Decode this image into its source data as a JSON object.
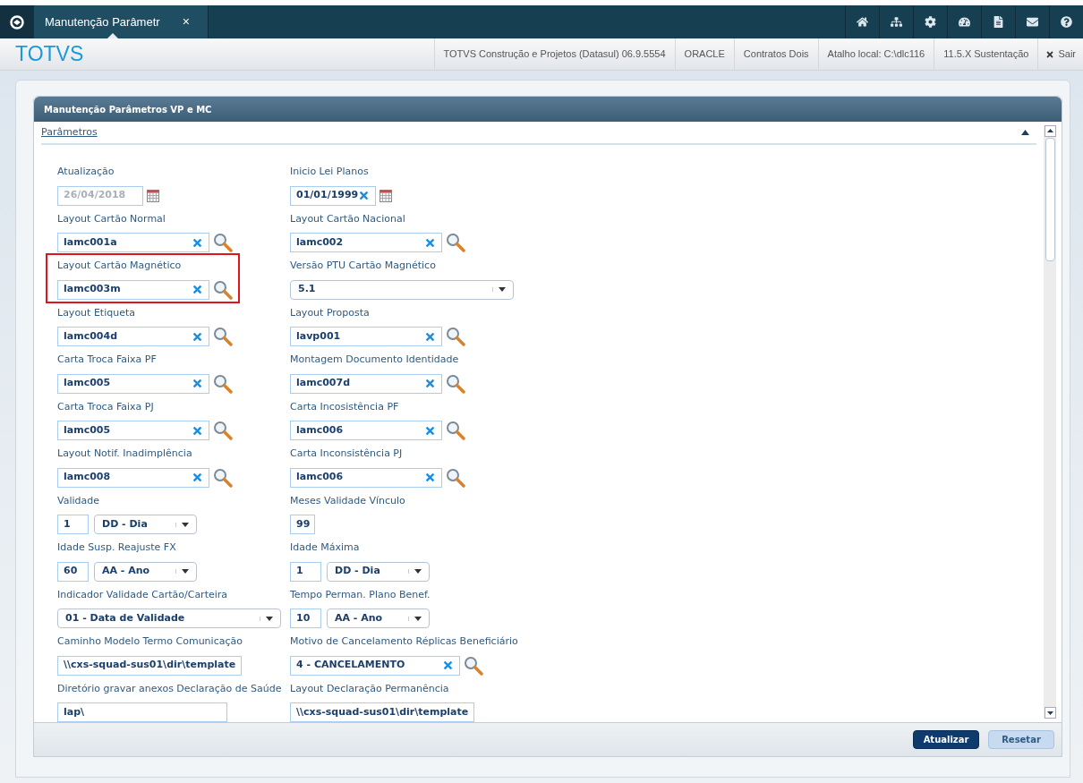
{
  "tab": {
    "title": "Manutenção Parâmetr",
    "close": "×",
    "selected": true
  },
  "brand": "TOTVS",
  "header_items": [
    "TOTVS Construção e Projetos (Datasul) 06.9.5554",
    "ORACLE",
    "Contratos Dois",
    "Atalho local: C:\\dlc116",
    "11.5.X Sustentação"
  ],
  "logout": "Sair",
  "panel": {
    "title": "Manutenção Parâmetros VP e MC",
    "section": "Parâmetros",
    "expanded": true,
    "rows": [
      [
        {
          "kind": "date",
          "label": "Atualização",
          "value": "26/04/2018",
          "disabled": true,
          "highlighted": false
        },
        {
          "kind": "date",
          "label": "Inicio Lei Planos",
          "value": "01/01/1999",
          "disabled": false,
          "highlighted": false
        }
      ],
      [
        {
          "kind": "lookup",
          "label": "Layout Cartão Normal",
          "value": "lamc001a",
          "highlighted": false
        },
        {
          "kind": "lookup",
          "label": "Layout Cartão Nacional",
          "value": "lamc002",
          "highlighted": false
        }
      ],
      [
        {
          "kind": "lookup",
          "label": "Layout Cartão Magnético",
          "value": "lamc003m",
          "highlighted": true
        },
        {
          "kind": "select",
          "label": "Versão PTU Cartão Magnético",
          "value": "5.1",
          "highlighted": false
        }
      ],
      [
        {
          "kind": "lookup",
          "label": "Layout Etiqueta",
          "value": "lamc004d",
          "highlighted": false
        },
        {
          "kind": "lookup",
          "label": "Layout Proposta",
          "value": "lavp001",
          "highlighted": false
        }
      ],
      [
        {
          "kind": "lookup",
          "label": "Carta Troca Faixa PF",
          "value": "lamc005",
          "highlighted": false
        },
        {
          "kind": "lookup",
          "label": "Montagem Documento Identidade",
          "value": "lamc007d",
          "highlighted": false
        }
      ],
      [
        {
          "kind": "lookup",
          "label": "Carta Troca Faixa PJ",
          "value": "lamc005",
          "highlighted": false
        },
        {
          "kind": "lookup",
          "label": "Carta Incosistência PF",
          "value": "lamc006",
          "highlighted": false
        }
      ],
      [
        {
          "kind": "lookup",
          "label": "Layout Notif. Inadimplência",
          "value": "lamc008",
          "highlighted": false
        },
        {
          "kind": "lookup",
          "label": "Carta Inconsistência PJ",
          "value": "lamc006",
          "highlighted": false
        }
      ],
      [
        {
          "kind": "number_select",
          "label": "Validade",
          "value": "1",
          "unit": "DD - Dia",
          "highlighted": false
        },
        {
          "kind": "number",
          "label": "Meses Validade Vínculo",
          "value": "99",
          "highlighted": false
        }
      ],
      [
        {
          "kind": "number_select",
          "label": "Idade Susp. Reajuste FX",
          "value": "60",
          "unit": "AA - Ano",
          "highlighted": false
        },
        {
          "kind": "number_select",
          "label": "Idade Máxima",
          "value": "1",
          "unit": "DD - Dia",
          "highlighted": false
        }
      ],
      [
        {
          "kind": "select",
          "label": "Indicador Validade Cartão/Carteira",
          "value": "01 - Data de Validade",
          "highlighted": false
        },
        {
          "kind": "number_select",
          "label": "Tempo Perman. Plano Benef.",
          "value": "10",
          "unit": "AA - Ano",
          "highlighted": false
        }
      ],
      [
        {
          "kind": "text",
          "label": "Caminho Modelo Termo Comunicação",
          "value": "\\\\cxs-squad-sus01\\dir\\template",
          "highlighted": false
        },
        {
          "kind": "lookup",
          "label": "Motivo de Cancelamento Réplicas Beneficiário",
          "value": "4 - CANCELAMENTO",
          "highlighted": false
        }
      ],
      [
        {
          "kind": "text",
          "label": "Diretório gravar anexos Declaração de Saúde",
          "value": "lap\\",
          "highlighted": false
        },
        {
          "kind": "text",
          "label": "Layout Declaração Permanência",
          "value": "\\\\cxs-squad-sus01\\dir\\template",
          "highlighted": false
        }
      ]
    ]
  },
  "buttons": [
    {
      "label": "Atualizar",
      "primary": true
    },
    {
      "label": "Resetar",
      "primary": false
    }
  ]
}
